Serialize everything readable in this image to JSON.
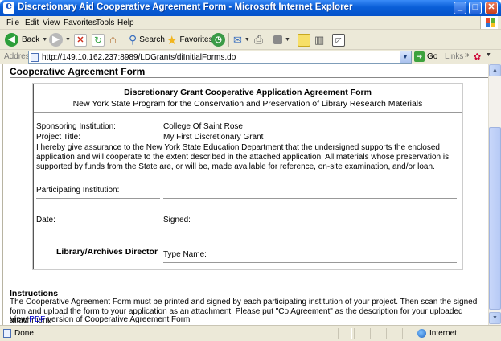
{
  "window": {
    "title": "Discretionary Aid Cooperative Agreement Form - Microsoft Internet Explorer"
  },
  "menu": [
    "File",
    "Edit",
    "View",
    "Favorites",
    "Tools",
    "Help"
  ],
  "toolbar": {
    "back": "Back",
    "search": "Search",
    "favorites": "Favorites"
  },
  "address": {
    "label": "Address",
    "url": "http://149.10.162.237:8989/LDGrants/diInitialForms.do",
    "go": "Go",
    "links": "Links"
  },
  "page": {
    "heading": "Cooperative Agreement Form",
    "box": {
      "title": "Discretionary Grant Cooperative Application Agreement Form",
      "subtitle": "New York State Program for the Conservation and Preservation of Library Research Materials",
      "sponsoring_label": "Sponsoring Institution:",
      "sponsoring_value": "College Of Saint Rose",
      "project_label": "Project Title:",
      "project_value": "My First Discretionary Grant",
      "assurance": "I hereby give assurance to the New York State Education Department that the undersigned supports the enclosed application and will cooperate to the extent described in the attached application. All materials whose preservation is supported by funds from the State are, or will be, made available for reference, on-site examination, and/or loan.",
      "participating_label": "Participating Institution:",
      "date_label": "Date:",
      "signed_label": "Signed:",
      "director_label": "Library/Archives Director",
      "typename_label": "Type Name:"
    },
    "instructions": {
      "title": "Instructions",
      "text": "The Cooperative Agreement Form must be printed and signed by each participating institution of your project. Then scan the signed form and upload the form to your application as an attachment. Please put \"Co Agreement\" as the description for your uploaded attachment.",
      "view_prefix": "View ",
      "pdf_link": "PDF",
      "view_suffix": " version of Cooperative Agreement Form"
    }
  },
  "status": {
    "text": "Done",
    "zone": "Internet"
  }
}
